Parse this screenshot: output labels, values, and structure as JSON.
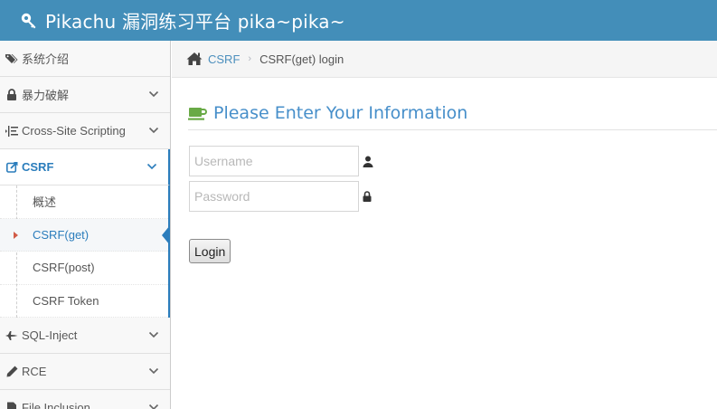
{
  "header": {
    "brand": "Pikachu 漏洞练习平台 pika~pika~",
    "brand_icon": "wrench-icon",
    "bg_color": "#438eb9"
  },
  "sidebar": {
    "items": [
      {
        "label": "系统介绍",
        "icon": "tags-icon"
      },
      {
        "label": "暴力破解",
        "icon": "lock-icon"
      },
      {
        "label": "Cross-Site Scripting",
        "icon": "indent-icon"
      },
      {
        "label": "CSRF",
        "icon": "share-icon",
        "active": true
      },
      {
        "label": "SQL-Inject",
        "icon": "fighter-jet-icon"
      },
      {
        "label": "RCE",
        "icon": "pencil-icon"
      },
      {
        "label": "File Inclusion",
        "icon": "file-icon"
      }
    ],
    "csrf_submenu": [
      {
        "label": "概述"
      },
      {
        "label": "CSRF(get)",
        "active": true
      },
      {
        "label": "CSRF(post)"
      },
      {
        "label": "CSRF Token"
      }
    ],
    "accent_color": "#2b7dbc"
  },
  "breadcrumb": {
    "home_icon": "home-icon",
    "link": "CSRF",
    "separator": "›",
    "current": "CSRF(get) login"
  },
  "form": {
    "title": "Please Enter Your Information",
    "title_icon": "coffee-icon",
    "title_color": "#478fca",
    "username_placeholder": "Username",
    "username_value": "",
    "password_placeholder": "Password",
    "password_value": "",
    "login_label": "Login"
  }
}
